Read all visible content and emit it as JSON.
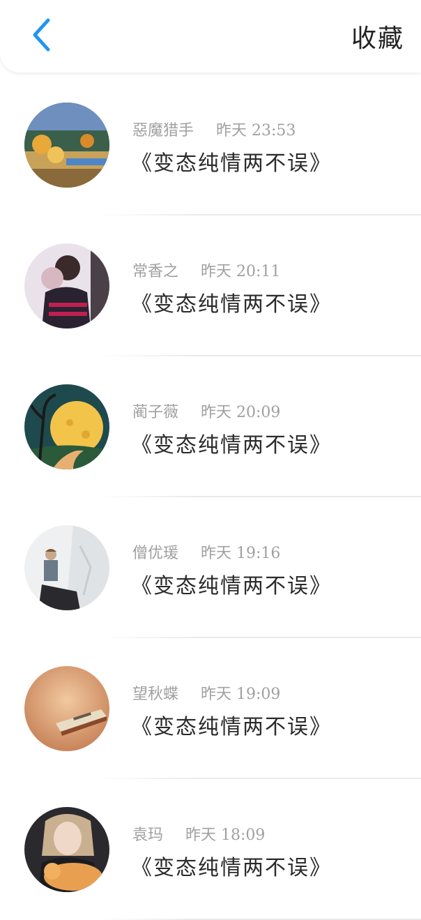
{
  "header": {
    "back_icon": "chevron-left-icon",
    "title": "收藏",
    "accent": "#2196F3"
  },
  "items": [
    {
      "user": "惡魔猎手",
      "time": "昨天 23:53",
      "title": "《变态纯情两不误》"
    },
    {
      "user": "常香之",
      "time": "昨天 20:11",
      "title": "《变态纯情两不误》"
    },
    {
      "user": "蔺子薇",
      "time": "昨天 20:09",
      "title": "《变态纯情两不误》"
    },
    {
      "user": "僧优瑗",
      "time": "昨天 19:16",
      "title": "《变态纯情两不误》"
    },
    {
      "user": "望秋蝶",
      "time": "昨天 19:09",
      "title": "《变态纯情两不误》"
    },
    {
      "user": "袁玛",
      "time": "昨天 18:09",
      "title": "《变态纯情两不误》"
    }
  ]
}
